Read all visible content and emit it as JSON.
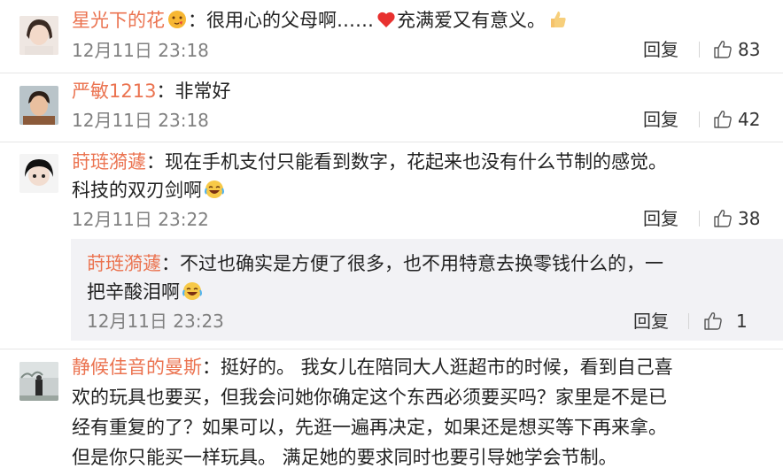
{
  "comments": [
    {
      "username": "星光下的花",
      "text": "很用心的父母啊……",
      "text_after_heart": "充满爱又有意义。",
      "time": "12月11日 23:18",
      "reply_label": "回复",
      "likes": "83"
    },
    {
      "username": "严敏1213",
      "text": "非常好",
      "time": "12月11日 23:18",
      "reply_label": "回复",
      "likes": "42"
    },
    {
      "username": "莳琏漪蘧",
      "text_line1": "现在手机支付只能看到数字，花起来也没有什么节制的感觉。",
      "text_line2": "科技的双刃剑啊",
      "time": "12月11日 23:22",
      "reply_label": "回复",
      "likes": "38",
      "sub_reply": {
        "username": "莳琏漪蘧",
        "text_line1": "不过也确实是方便了很多，也不用特意去换零钱什么的，一",
        "text_line2": "把辛酸泪啊",
        "time": "12月11日 23:23",
        "reply_label": "回复",
        "likes": "1"
      }
    },
    {
      "username": "静候佳音的曼斯",
      "text_line1": "挺好的。 我女儿在陪同大人逛超市的时候，看到自己喜",
      "text_line2": "欢的玩具也要买，但我会问她你确定这个东西必须要买吗？家里是不是已",
      "text_line3": "经有重复的了？如果可以，先逛一遍再决定，如果还是想买等下再来拿。",
      "text_line4": "但是你只能买一样玩具。 满足她的要求同时也要引导她学会节制。"
    }
  ],
  "colors": {
    "username": "#eb7350",
    "meta": "#808080",
    "divider": "#e6e6e6",
    "sub_bg": "#f2f2f5"
  },
  "icons": [
    "thumbs-up-icon",
    "heart-emoji-icon",
    "thumbs-up-emoji-icon",
    "laughing-crying-emoji-icon",
    "kiss-emoji-icon"
  ]
}
